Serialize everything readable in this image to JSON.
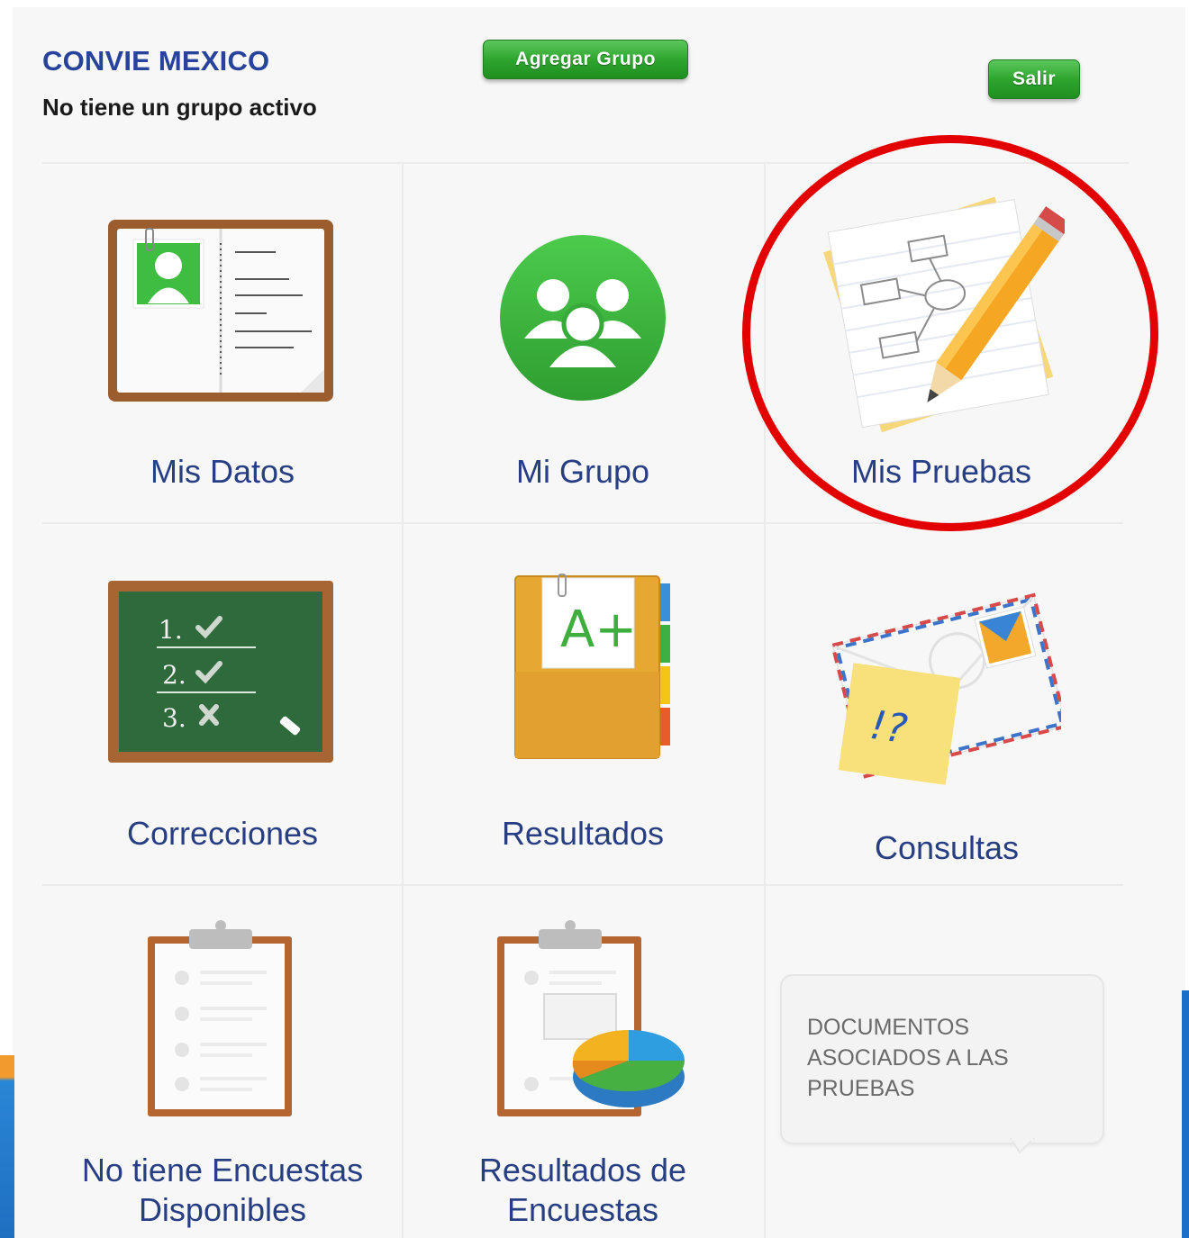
{
  "header": {
    "org_name": "CONVIE MEXICO",
    "status": "No tiene un grupo activo",
    "add_group_label": "Agregar Grupo",
    "logout_label": "Salir"
  },
  "tiles": {
    "mis_datos": "Mis Datos",
    "mi_grupo": "Mi Grupo",
    "mis_pruebas": "Mis Pruebas",
    "correcciones": "Correcciones",
    "resultados": "Resultados",
    "consultas": "Consultas",
    "encuestas_line1": "No tiene Encuestas",
    "encuestas_line2": "Disponibles",
    "resultados_encuestas_line1": "Resultados de",
    "resultados_encuestas_line2": "Encuestas"
  },
  "documents_note": {
    "line1": "DOCUMENTOS",
    "line2": "ASOCIADOS A LAS",
    "line3": "PRUEBAS"
  },
  "chalkboard": {
    "item1": "1.",
    "item2": "2.",
    "item3": "3."
  },
  "grade_text": "A+",
  "query_text": "!?",
  "colors": {
    "title_blue": "#27439b",
    "label_blue": "#273e82",
    "button_green": "#2fa52f",
    "highlight_red": "#e30000"
  }
}
